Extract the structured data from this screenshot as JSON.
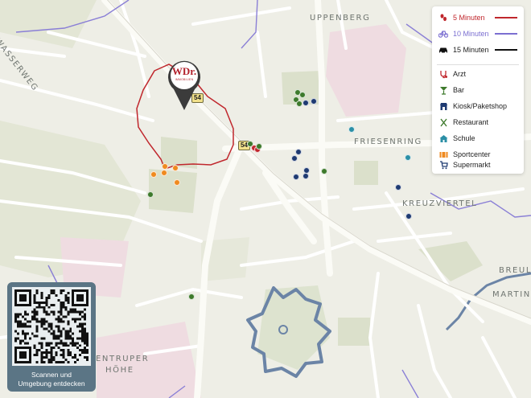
{
  "map": {
    "places": {
      "uppenberg": "UPPENBERG",
      "friesenring": "FRIESENRING",
      "kreuzviertel": "KREUZVIERTEL",
      "wasserweg": "WASSERWEG",
      "breul": "BREUL",
      "martini": "MARTINI",
      "entruper": "ENTRUPER",
      "hoehe": "HÖHE"
    },
    "road_shield": "54",
    "road_shield_small": "54",
    "marker_logo": "WDr.",
    "marker_sub": "IMMOBILIEN"
  },
  "legend": {
    "isochrones": [
      {
        "label": "5 Minuten",
        "mode": "walk-icon",
        "color": "#c0272d"
      },
      {
        "label": "10 Minuten",
        "mode": "bike-icon",
        "color": "#7b6fd1"
      },
      {
        "label": "15 Minuten",
        "mode": "car-icon",
        "color": "#111111"
      }
    ],
    "categories": [
      {
        "label": "Arzt",
        "icon": "stethoscope-icon",
        "color": "#c0272d"
      },
      {
        "label": "Bar",
        "icon": "cocktail-icon",
        "color": "#3e7a2c"
      },
      {
        "label": "Kiosk/Paketshop",
        "icon": "shop-icon",
        "color": "#1f3b72"
      },
      {
        "label": "Restaurant",
        "icon": "cutlery-icon",
        "color": "#3e7a2c"
      },
      {
        "label": "Schule",
        "icon": "school-icon",
        "color": "#2b8fa6"
      },
      {
        "label": "Sportcenter",
        "icon": "sport-icon",
        "color": "#ef8a1f"
      },
      {
        "label": "Supermarkt",
        "icon": "cart-icon",
        "color": "#1f3b72"
      }
    ]
  },
  "qr": {
    "caption_line1": "Scannen und",
    "caption_line2": "Umgebung entdecken"
  }
}
